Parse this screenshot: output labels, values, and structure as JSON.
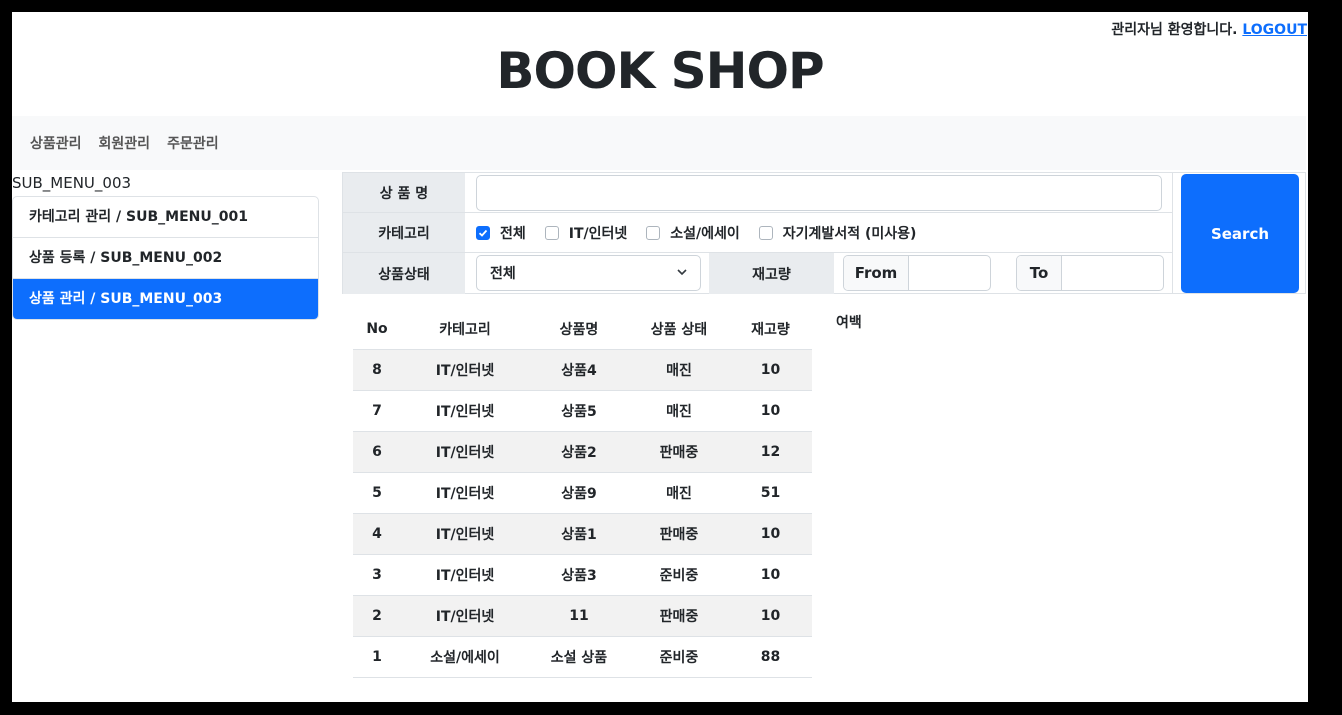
{
  "header": {
    "welcome": "관리자님 환영합니다.",
    "logout": "LOGOUT",
    "brand": "BOOK SHOP"
  },
  "nav": {
    "items": [
      "상품관리",
      "회원관리",
      "주문관리"
    ]
  },
  "sidebar": {
    "title": "SUB_MENU_003",
    "items": [
      {
        "label": "카테고리 관리 / SUB_MENU_001",
        "active": false
      },
      {
        "label": "상품 등록 / SUB_MENU_002",
        "active": false
      },
      {
        "label": "상품 관리 / SUB_MENU_003",
        "active": true
      }
    ]
  },
  "search": {
    "name_label": "상 품 명",
    "name_value": "",
    "category_label": "카테고리",
    "categories": [
      {
        "label": "전체",
        "checked": true
      },
      {
        "label": "IT/인터넷",
        "checked": false
      },
      {
        "label": "소설/에세이",
        "checked": false
      },
      {
        "label": "자기계발서적 (미사용)",
        "checked": false
      }
    ],
    "status_label": "상품상태",
    "status_value": "전체",
    "stock_label": "재고량",
    "from_label": "From",
    "to_label": "To",
    "button": "Search"
  },
  "results": {
    "columns": [
      "No",
      "카테고리",
      "상품명",
      "상품 상태",
      "재고량"
    ],
    "rows": [
      [
        "8",
        "IT/인터넷",
        "상품4",
        "매진",
        "10"
      ],
      [
        "7",
        "IT/인터넷",
        "상품5",
        "매진",
        "10"
      ],
      [
        "6",
        "IT/인터넷",
        "상품2",
        "판매중",
        "12"
      ],
      [
        "5",
        "IT/인터넷",
        "상품9",
        "매진",
        "51"
      ],
      [
        "4",
        "IT/인터넷",
        "상품1",
        "판매중",
        "10"
      ],
      [
        "3",
        "IT/인터넷",
        "상품3",
        "준비중",
        "10"
      ],
      [
        "2",
        "IT/인터넷",
        "11",
        "판매중",
        "10"
      ],
      [
        "1",
        "소설/에세이",
        "소설 상품",
        "준비중",
        "88"
      ]
    ]
  },
  "margin_note": "여백",
  "colors": {
    "primary": "#0d6efd",
    "header_bg": "#e9ecef",
    "nav_bg": "#f8f9fa"
  }
}
